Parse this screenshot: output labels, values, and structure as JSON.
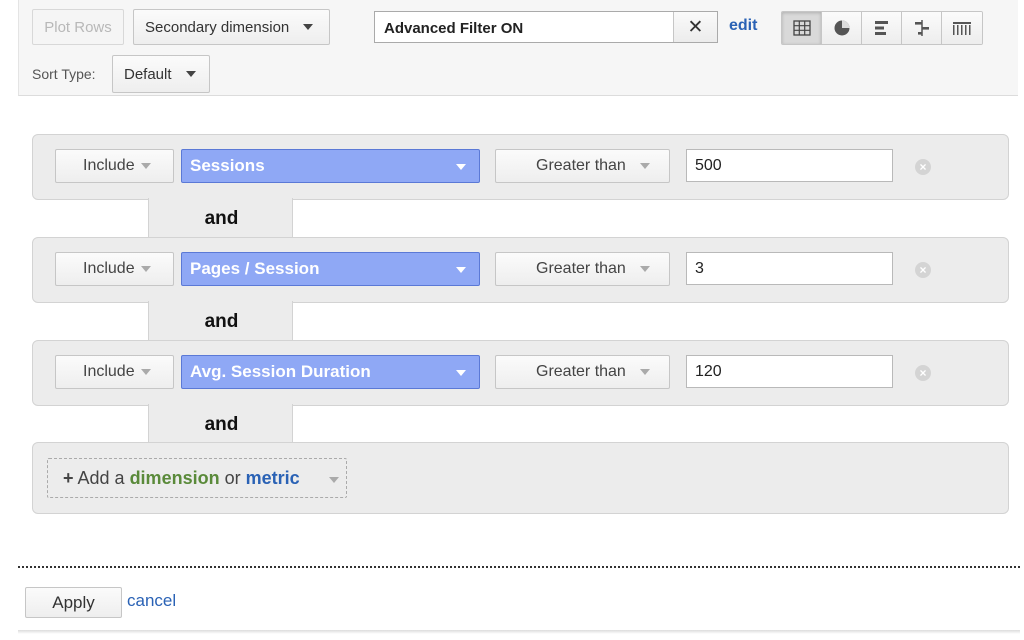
{
  "toolbar": {
    "plot_rows_label": "Plot Rows",
    "secondary_dimension_label": "Secondary dimension",
    "filter_value": "Advanced Filter ON",
    "clear_glyph": "✕",
    "edit_label": "edit",
    "sort_type_label": "Sort Type:",
    "sort_type_value": "Default",
    "view_buttons": [
      "table-view-icon",
      "pie-view-icon",
      "performance-view-icon",
      "comparison-view-icon",
      "pivot-view-icon"
    ]
  },
  "conditions": [
    {
      "include": "Include",
      "metric": "Sessions",
      "operator": "Greater than",
      "value": "500"
    },
    {
      "include": "Include",
      "metric": "Pages / Session",
      "operator": "Greater than",
      "value": "3"
    },
    {
      "include": "Include",
      "metric": "Avg. Session Duration",
      "operator": "Greater than",
      "value": "120"
    }
  ],
  "connector_label": "and",
  "add_row": {
    "prefix": "+",
    "add_text": "Add a",
    "dimension_text": "dimension",
    "or_text": "or",
    "metric_text": "metric"
  },
  "footer": {
    "apply_label": "Apply",
    "cancel_label": "cancel"
  },
  "colors": {
    "metric_select_bg": "#8fa8f5",
    "link_blue": "#2a62b5",
    "dimension_green": "#5a8a3a"
  }
}
